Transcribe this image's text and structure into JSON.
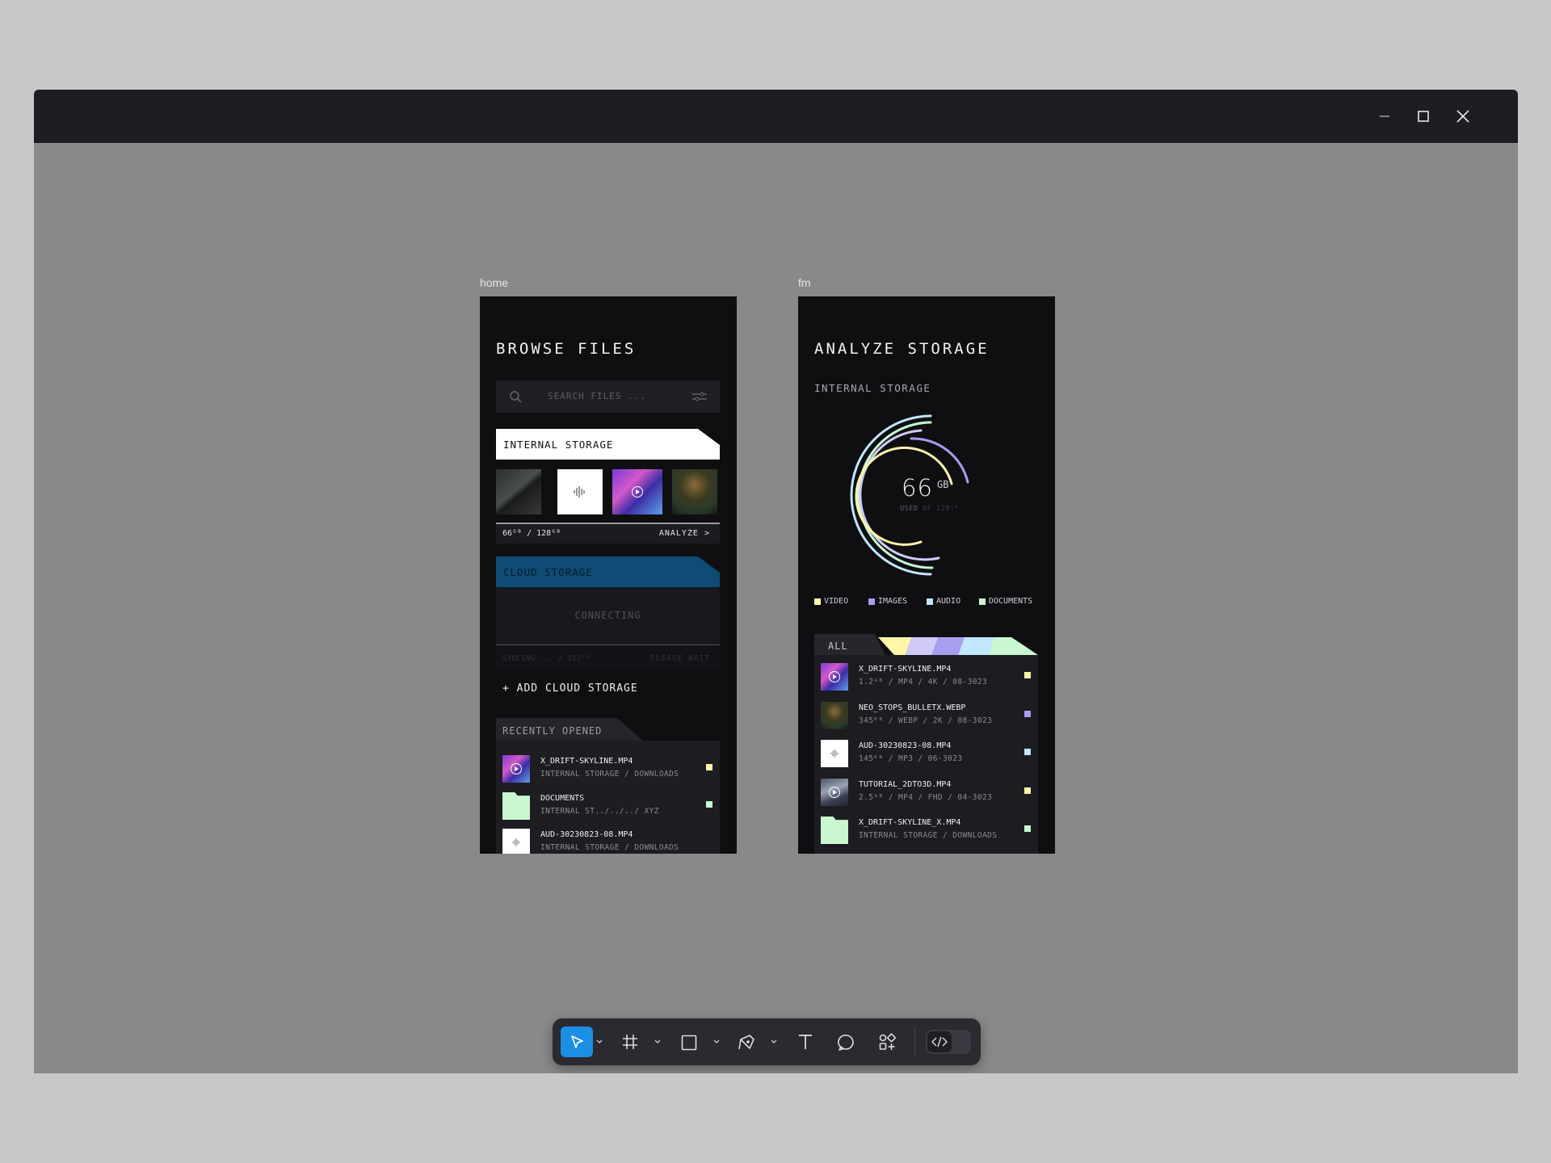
{
  "colors": {
    "video": "#fff6a8",
    "images": "#a89ef0",
    "audio": "#bfe7ff",
    "documents": "#c8f7d0",
    "cloud": "#0e4c74",
    "select_blue": "#1a8fe3"
  },
  "window": {
    "controls": [
      "minimize-icon",
      "maximize-icon",
      "close-icon"
    ]
  },
  "frames": {
    "home_label": "home",
    "fm_label": "fm"
  },
  "home": {
    "title": "BROWSE FILES",
    "search_placeholder": "SEARCH FILES ...",
    "internal_label": "INTERNAL STORAGE",
    "usage_label": "66ᴳᴮ / 128ᴳᴮ",
    "analyze_label": "ANALYZE >",
    "cloud_label": "CLOUD STORAGE",
    "connecting_label": "CONNECTING",
    "syncing_label": "SYNCING ... / 512ᴳᴮ",
    "please_wait_label": "PLEASE WAIT",
    "add_cloud_label": "+ ADD CLOUD STORAGE",
    "recent_label": "RECENTLY OPENED",
    "recent": [
      {
        "name": "X_DRIFT-SKYLINE.MP4",
        "path": "INTERNAL STORAGE / DOWNLOADS",
        "icon": "video-thumbnail",
        "tag": "video"
      },
      {
        "name": "DOCUMENTS",
        "path": "INTERNAL ST../../../ XYZ",
        "icon": "folder-icon",
        "tag": "documents"
      },
      {
        "name": "AUD-30230823-08.MP4",
        "path": "INTERNAL STORAGE / DOWNLOADS",
        "icon": "audio-icon",
        "tag": "audio"
      }
    ]
  },
  "fm": {
    "title": "ANALYZE STORAGE",
    "internal_label": "INTERNAL STORAGE",
    "used_value": "66",
    "used_unit": "GB",
    "used_prefix": "USED",
    "used_suffix": "OF 128ᴳᴮ",
    "legend": [
      "VIDEO",
      "IMAGES",
      "AUDIO",
      "DOCUMENTS"
    ],
    "all_label": "ALL",
    "files": [
      {
        "name": "X_DRIFT-SKYLINE.MP4",
        "meta": "1.2ᴳᴮ / MP4 / 4K / 08-3023",
        "icon": "video-thumbnail",
        "tag": "video"
      },
      {
        "name": "NEO_STOPS_BULLETX.WEBP",
        "meta": "345ᴷᴮ / WEBP / 2K / 08-3023",
        "icon": "photo-thumbnail",
        "tag": "images"
      },
      {
        "name": "AUD-30230823-08.MP4",
        "meta": "145ᴷᴮ / MP3 / 06-3023",
        "icon": "audio-icon",
        "tag": "audio"
      },
      {
        "name": "TUTORIAL_2DTO3D.MP4",
        "meta": "2.5ᴳᴮ / MP4 / FHD / 04-3023",
        "icon": "video-thumbnail",
        "tag": "video"
      },
      {
        "name": "X_DRIFT-SKYLINE_X.MP4",
        "meta": "INTERNAL STORAGE / DOWNLOADS",
        "icon": "folder-icon",
        "tag": "documents"
      }
    ]
  },
  "toolbar": {
    "tools": [
      "move-tool-icon",
      "frame-tool-icon",
      "rectangle-tool-icon",
      "pen-tool-icon",
      "text-tool-icon",
      "comment-tool-icon",
      "components-icon",
      "dev-mode-icon"
    ],
    "active": "move-tool-icon"
  }
}
